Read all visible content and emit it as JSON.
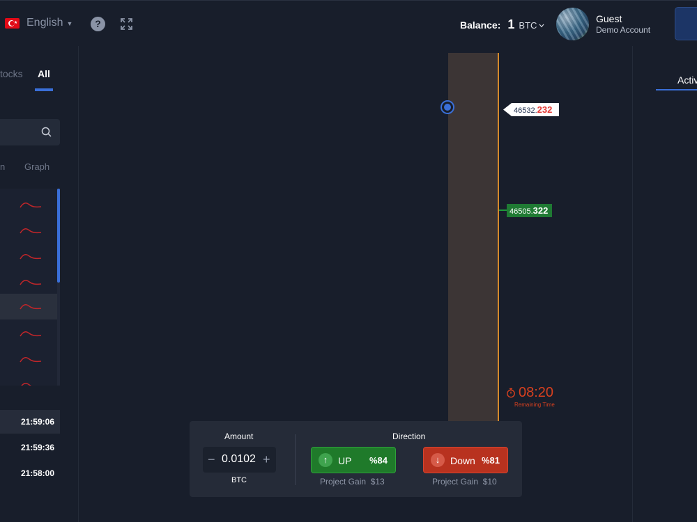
{
  "header": {
    "language": "English",
    "balance_label": "Balance:",
    "balance_value": "1",
    "balance_currency": "BTC",
    "user_name": "Guest",
    "user_subtitle": "Demo Account"
  },
  "left_panel": {
    "tabs": [
      "tocks",
      "All"
    ],
    "columns": [
      "n",
      "Graph"
    ],
    "times": [
      "21:59:06",
      "21:59:36",
      "21:58:00"
    ]
  },
  "right_panel": {
    "tab": "Activ"
  },
  "chart": {
    "price_marker_int": "46532.",
    "price_marker_dec": "232",
    "current_price_int": "46505.",
    "current_price_dec": "322",
    "timer": "08:20",
    "timer_label": "Remaining Time"
  },
  "order": {
    "amount_heading": "Amount",
    "minus": "−",
    "amount_value": "0.0102",
    "plus": "+",
    "amount_currency": "BTC",
    "direction_heading": "Direction",
    "up_label": "UP",
    "up_pct": "%84",
    "up_gain": "Project Gain  $13",
    "down_label": "Down",
    "down_pct": "%81",
    "down_gain": "Project Gain  $10"
  },
  "colors": {
    "accent": "#3a6fd8",
    "up": "#1f7a2a",
    "down": "#b8321f",
    "timer": "#d7401f"
  }
}
